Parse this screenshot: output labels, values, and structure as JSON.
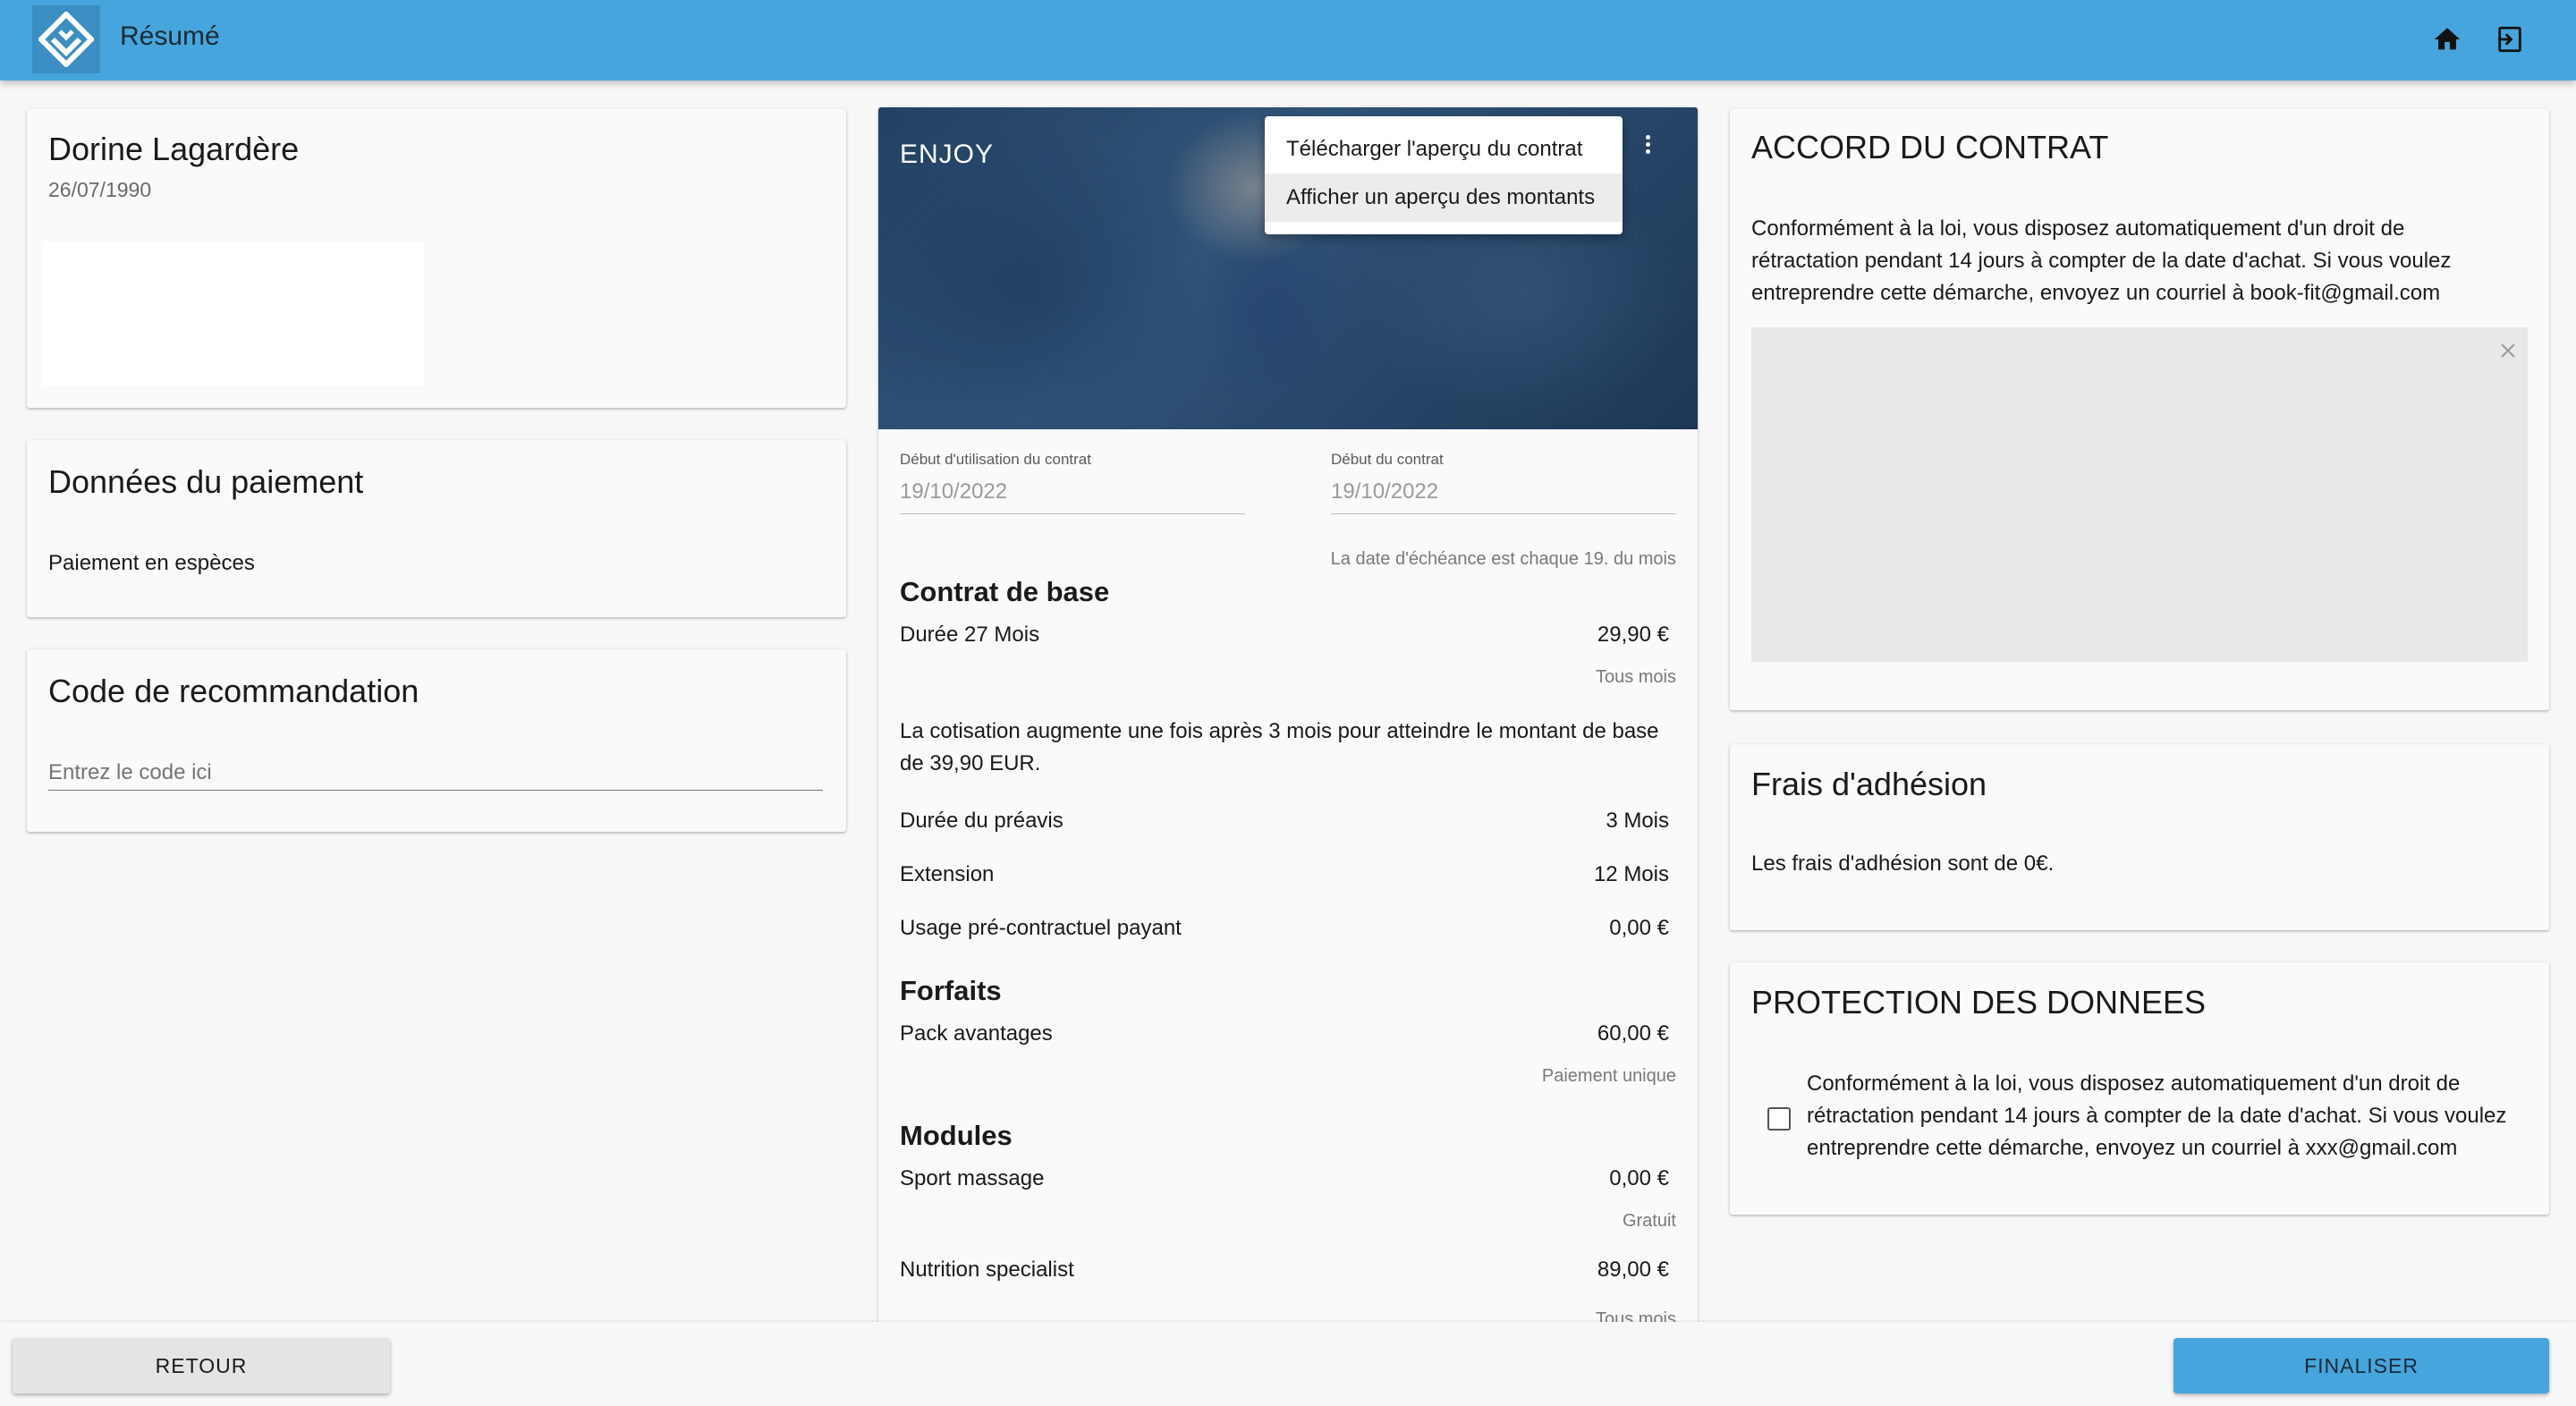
{
  "app": {
    "title": "Résumé",
    "icons": {
      "logo": "diamond-logo",
      "home": "home-icon",
      "logout": "exit-icon"
    },
    "accent": "#46a5dc"
  },
  "customer": {
    "name": "Dorine Lagardère",
    "birthdate": "26/07/1990"
  },
  "payment": {
    "title": "Données du paiement",
    "method": "Paiement en espèces"
  },
  "referral": {
    "title": "Code de recommandation",
    "placeholder": "Entrez le code ici"
  },
  "contract": {
    "plan_name": "ENJOY",
    "menu": {
      "items": [
        "Télécharger l'aperçu du contrat",
        "Afficher un aperçu des montants"
      ],
      "active_index": 1
    },
    "usage_start": {
      "label": "Début d'utilisation du contrat",
      "value": "19/10/2022"
    },
    "contract_start": {
      "label": "Début du contrat",
      "value": "19/10/2022"
    },
    "due_note": "La date d'échéance est chaque 19. du mois",
    "base": {
      "title": "Contrat de base",
      "duration_label": "Durée 27 Mois",
      "price": "29,90 €",
      "period": "Tous mois",
      "note": "La cotisation augmente une fois après 3 mois pour atteindre le montant de base de 39,90 EUR.",
      "rows": [
        {
          "label": "Durée du préavis",
          "value": "3 Mois"
        },
        {
          "label": "Extension",
          "value": "12 Mois"
        },
        {
          "label": "Usage pré-contractuel payant",
          "value": "0,00 €"
        }
      ]
    },
    "packages": {
      "title": "Forfaits",
      "items": [
        {
          "label": "Pack avantages",
          "value": "60,00 €",
          "sub": "Paiement unique"
        }
      ]
    },
    "modules": {
      "title": "Modules",
      "items": [
        {
          "label": "Sport massage",
          "value": "0,00 €",
          "sub": "Gratuit"
        },
        {
          "label": "Nutrition specialist",
          "value": "89,00 €",
          "sub": "Tous mois"
        }
      ]
    }
  },
  "agreement": {
    "title": "ACCORD DU CONTRAT",
    "text_lines": [
      "Conformément à la loi, vous disposez automatiquement d'un droit de",
      "rétractation pendant 14 jours à compter de la date d'achat. Si vous voulez",
      "entreprendre cette démarche, envoyez un courriel à book-fit@gmail.com"
    ]
  },
  "membership_fee": {
    "title": "Frais d'adhésion",
    "text": "Les frais d'adhésion sont de 0€."
  },
  "data_protection": {
    "title": "PROTECTION DES DONNEES",
    "text_lines": [
      "Conformément à la loi, vous disposez automatiquement d'un droit de",
      "rétractation pendant 14 jours à compter de la date d'achat. Si vous voulez",
      "entreprendre cette démarche, envoyez un courriel à xxx@gmail.com"
    ],
    "checked": false
  },
  "footer": {
    "back_label": "RETOUR",
    "finish_label": "FINALISER"
  }
}
